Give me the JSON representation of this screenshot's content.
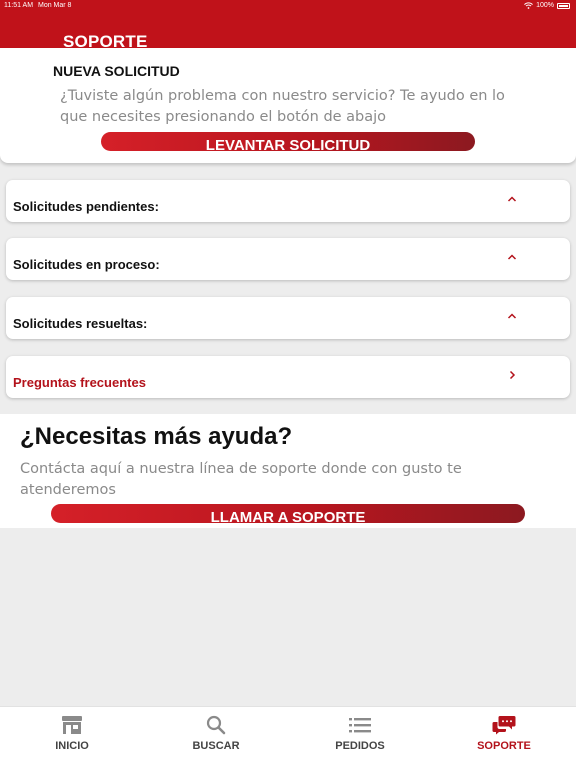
{
  "status_bar": {
    "time": "11:51 AM",
    "date": "Mon Mar 8",
    "battery": "100%"
  },
  "header": {
    "title": "SOPORTE"
  },
  "new_request": {
    "heading": "NUEVA SOLICITUD",
    "description": "¿Tuviste algún problema con nuestro servicio? Te ayudo en lo que necesites presionando el botón de abajo",
    "button_label": "LEVANTAR SOLICITUD"
  },
  "sections": [
    {
      "label": "Solicitudes pendientes:",
      "icon": "chevron-up-icon"
    },
    {
      "label": "Solicitudes en proceso:",
      "icon": "chevron-up-icon"
    },
    {
      "label": "Solicitudes resueltas:",
      "icon": "chevron-up-icon"
    },
    {
      "label": "Preguntas frecuentes",
      "icon": "chevron-right-icon"
    }
  ],
  "help": {
    "title": "¿Necesitas más ayuda?",
    "description": "Contácta aquí a nuestra línea de soporte donde con gusto te atenderemos",
    "button_label": "LLAMAR A SOPORTE"
  },
  "tabs": [
    {
      "label": "INICIO",
      "icon": "store-icon",
      "active": false
    },
    {
      "label": "BUSCAR",
      "icon": "search-icon",
      "active": false
    },
    {
      "label": "PEDIDOS",
      "icon": "list-icon",
      "active": false
    },
    {
      "label": "SOPORTE",
      "icon": "chat-bubbles-icon",
      "active": true
    }
  ],
  "colors": {
    "brand_red": "#c0121a",
    "accent_red_text": "#b3121b",
    "background": "#ededed"
  }
}
